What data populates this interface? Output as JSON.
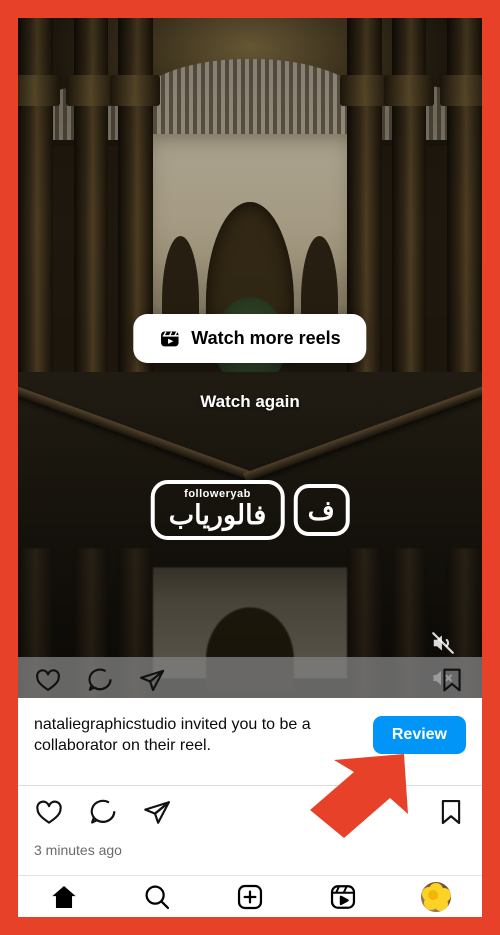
{
  "frame": {
    "accent_color": "#E8412A",
    "annotation_arrow": "red-arrow-pointing-to-review-button"
  },
  "reel": {
    "scene_description": "Alhambra courtyard with arches, columns and reflecting pool",
    "overlay": {
      "watch_more_label": "Watch more reels",
      "watch_more_icon": "reels-icon",
      "watch_again_label": "Watch again"
    },
    "watermark": {
      "latin_text": "followeryab",
      "persian_text": "فالوریاب",
      "mark_text": "ف"
    },
    "audio": {
      "ghost_icon": "muted-speaker-icon",
      "button_icon": "muted-speaker-icon",
      "state": "muted"
    },
    "strip_actions": [
      {
        "name": "like",
        "icon": "heart-icon"
      },
      {
        "name": "comment",
        "icon": "comment-icon"
      },
      {
        "name": "share",
        "icon": "share-paper-plane-icon"
      },
      {
        "name": "save",
        "icon": "bookmark-icon"
      }
    ]
  },
  "invite": {
    "message": "nataliegraphicstudio invited you to be a collaborator on their reel.",
    "username": "nataliegraphicstudio",
    "review_label": "Review",
    "review_color": "#0095F6"
  },
  "post": {
    "actions": [
      {
        "name": "like",
        "icon": "heart-icon"
      },
      {
        "name": "comment",
        "icon": "comment-icon"
      },
      {
        "name": "share",
        "icon": "share-paper-plane-icon"
      },
      {
        "name": "save",
        "icon": "bookmark-icon"
      }
    ],
    "timestamp": "3 minutes ago"
  },
  "tab_bar": {
    "items": [
      {
        "name": "home",
        "icon": "home-icon",
        "active": true
      },
      {
        "name": "search",
        "icon": "search-icon",
        "active": false
      },
      {
        "name": "create",
        "icon": "plus-square-icon",
        "active": false
      },
      {
        "name": "reels",
        "icon": "reels-icon",
        "active": false
      },
      {
        "name": "profile",
        "icon": "avatar-icon",
        "active": false
      }
    ]
  }
}
